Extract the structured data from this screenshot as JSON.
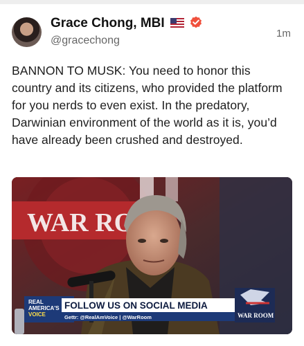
{
  "post": {
    "author_name": "Grace Chong, MBI",
    "handle": "@gracechong",
    "timestamp": "1m",
    "text": "BANNON TO MUSK: You need to honor this country and its citizens, who provided the platform for you nerds to even exist. In the predatory, Darwinian environment of the world as it is, you’d have already been crushed and destroyed.",
    "verified_color": "#f0503c"
  },
  "media": {
    "backdrop_text": "WAR RO",
    "banner": {
      "logo_line1": "REAL",
      "logo_line2": "AMERICA'S",
      "logo_line3": "VOICE",
      "headline": "FOLLOW US ON SOCIAL MEDIA",
      "subline": "Gettr: @RealAmVoice | @WarRoom",
      "badge_text": "WAR ROOM"
    }
  }
}
